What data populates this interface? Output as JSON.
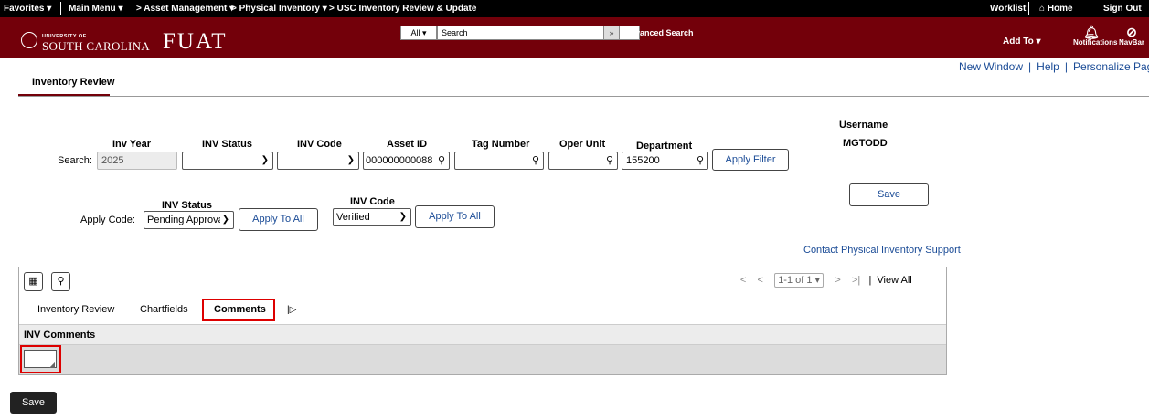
{
  "topbar": {
    "favorites": "Favorites ▾",
    "main_menu": "Main Menu ▾",
    "crumb1": "> Asset Management ▾",
    "crumb2": "> Physical Inventory ▾",
    "crumb3": "> USC Inventory Review & Update",
    "worklist": "Worklist",
    "home": "Home",
    "signout": "Sign Out"
  },
  "header": {
    "logo_small": "UNIVERSITY OF",
    "logo_big": "SOUTH CAROLINA",
    "app_title": "FUAT",
    "search_category": "All",
    "search_placeholder": "Search",
    "advanced_search": "Advanced Search",
    "add_to": "Add To ▾",
    "notifications": "Notifications",
    "navbar": "NavBar"
  },
  "links": {
    "new_window": "New Window",
    "help": "Help",
    "personalize": "Personalize Page",
    "separator": "|"
  },
  "page_tab": "Inventory Review",
  "search": {
    "label": "Search:",
    "inv_year_label": "Inv Year",
    "inv_year": "2025",
    "inv_status_label": "INV Status",
    "inv_code_label": "INV Code",
    "asset_id_label": "Asset ID",
    "asset_id": "000000000088",
    "tag_number_label": "Tag Number",
    "oper_unit_label": "Oper Unit",
    "department_label": "Department",
    "department": "155200",
    "apply_filter": "Apply Filter"
  },
  "user": {
    "label": "Username",
    "value": "MGTODD",
    "save": "Save"
  },
  "apply_code": {
    "label": "Apply Code:",
    "inv_status_label": "INV Status",
    "inv_status_value": "Pending Approva",
    "apply_all_1": "Apply To All",
    "inv_code_label": "INV Code",
    "inv_code_value": "Verified",
    "apply_all_2": "Apply To All"
  },
  "support_link": "Contact Physical Inventory Support",
  "grid": {
    "pager": "1-1 of 1",
    "view_all": "View All",
    "tabs": [
      "Inventory Review",
      "Chartfields",
      "Comments"
    ],
    "column": "INV Comments"
  },
  "save_bottom": "Save",
  "colors": {
    "header": "#73000a",
    "link": "#1a4b96",
    "highlight": "#dd0000"
  }
}
